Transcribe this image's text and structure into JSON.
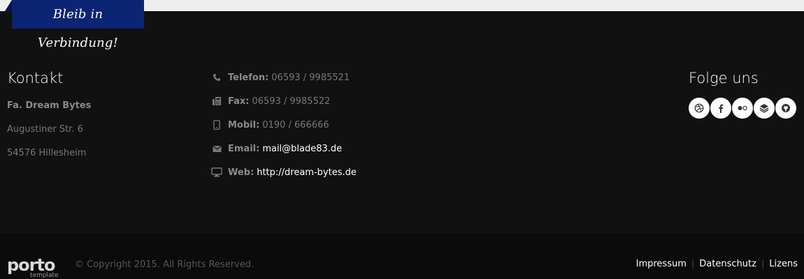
{
  "ribbon": {
    "label": "Bleib in Verbindung!"
  },
  "kontakt": {
    "title": "Kontakt",
    "company": "Fa. Dream Bytes",
    "street": "Augustiner Str. 6",
    "city": "54576 Hillesheim"
  },
  "contact_info": {
    "phone": {
      "label": "Telefon:",
      "value": "06593 / 9985521",
      "icon": "phone-icon"
    },
    "fax": {
      "label": "Fax:",
      "value": "06593 / 9985522",
      "icon": "fax-icon"
    },
    "mobile": {
      "label": "Mobil:",
      "value": "0190 / 666666",
      "icon": "mobile-icon"
    },
    "email": {
      "label": "Email:",
      "value": "mail@blade83.de",
      "icon": "envelope-icon"
    },
    "web": {
      "label": "Web:",
      "value": "http://dream-bytes.de",
      "icon": "desktop-icon"
    }
  },
  "social": {
    "title": "Folge uns",
    "icons": [
      "dribbble-icon",
      "facebook-icon",
      "flickr-icon",
      "stack-icon",
      "github-icon"
    ]
  },
  "bottom": {
    "logo_main": "porto",
    "logo_sub": "template",
    "copyright": "© Copyright 2015. All Rights Reserved.",
    "nav": [
      "Impressum",
      "Datenschutz",
      "Lizens"
    ]
  },
  "colors": {
    "ribbon": "#0c2474",
    "footer_bg": "#111111",
    "bottom_bg": "#0b0b0b",
    "topbar": "#eeeeee"
  }
}
